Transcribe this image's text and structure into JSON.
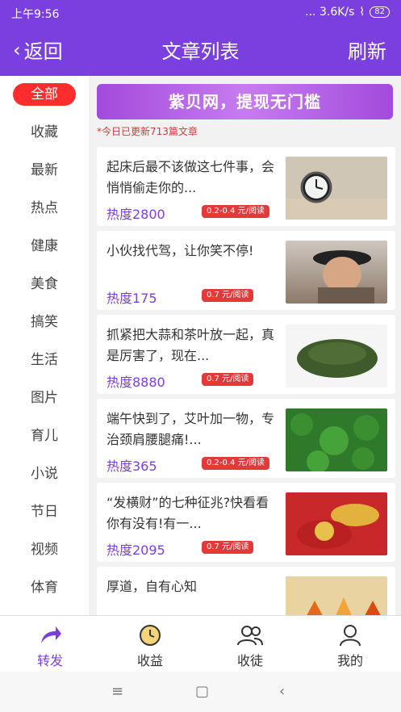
{
  "status": {
    "time": "上午9:56",
    "signal_text": "... 3.6K/s",
    "battery": "82"
  },
  "header": {
    "back_label": "返回",
    "title": "文章列表",
    "refresh_label": "刷新"
  },
  "sidebar": {
    "items": [
      {
        "label": "全部",
        "active": true
      },
      {
        "label": "收藏"
      },
      {
        "label": "最新"
      },
      {
        "label": "热点"
      },
      {
        "label": "健康"
      },
      {
        "label": "美食"
      },
      {
        "label": "搞笑"
      },
      {
        "label": "生活"
      },
      {
        "label": "图片"
      },
      {
        "label": "育儿"
      },
      {
        "label": "小说"
      },
      {
        "label": "节日"
      },
      {
        "label": "视频"
      },
      {
        "label": "体育"
      }
    ]
  },
  "banner": {
    "text": "紫贝网，提现无门槛"
  },
  "notice": "*今日已更新713篇文章",
  "articles": [
    {
      "title": "起床后最不该做这七件事，会悄悄偷走你的...",
      "heat": "热度2800",
      "price": "0.2-0.4 元/阅读",
      "thumb_color": "#c9c0b0"
    },
    {
      "title": "小伙找代驾，让你笑不停!",
      "heat": "热度175",
      "price": "0.7 元/阅读",
      "thumb_color": "#6e5a4a"
    },
    {
      "title": "抓紧把大蒜和茶叶放一起，真是厉害了，现在...",
      "heat": "热度8880",
      "price": "0.7 元/阅读",
      "thumb_color": "#3f5b2c"
    },
    {
      "title": "端午快到了，艾叶加一物，专治颈肩腰腿痛!...",
      "heat": "热度365",
      "price": "0.2-0.4 元/阅读",
      "thumb_color": "#2f7a2a"
    },
    {
      "title": "“发横财”的七种征兆?快看看你有没有!有一...",
      "heat": "热度2095",
      "price": "0.7 元/阅读",
      "thumb_color": "#c8282a"
    },
    {
      "title": "厚道，自有心知",
      "heat": "",
      "price": "",
      "thumb_color": "#e6a23a"
    }
  ],
  "tabs": [
    {
      "label": "转发",
      "icon": "share-icon",
      "active": true
    },
    {
      "label": "收益",
      "icon": "clock-icon"
    },
    {
      "label": "收徒",
      "icon": "people-icon"
    },
    {
      "label": "我的",
      "icon": "user-icon"
    }
  ],
  "colors": {
    "primary": "#7b3fe0",
    "accent": "#ff2d2d"
  }
}
